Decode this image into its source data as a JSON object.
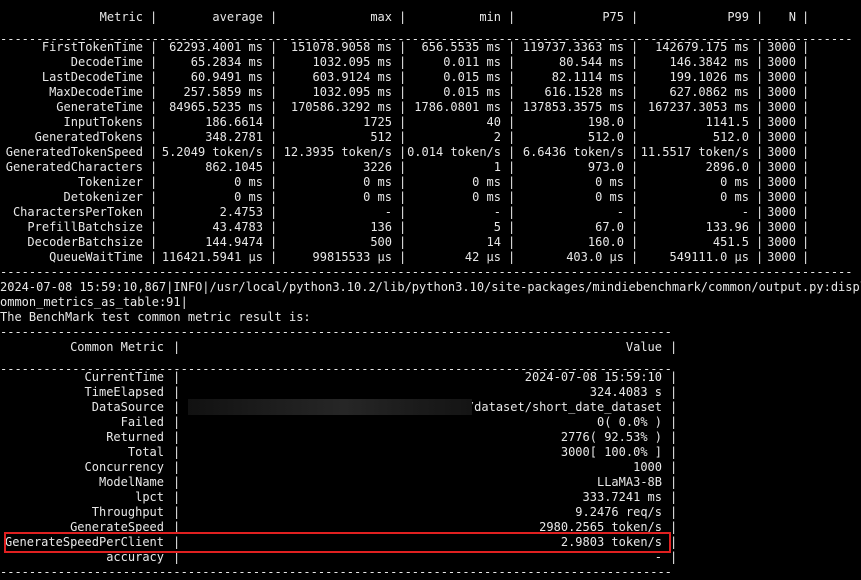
{
  "table1": {
    "headers": [
      "Metric",
      "average",
      "max",
      "min",
      "P75",
      "P99",
      "N"
    ],
    "rows": [
      [
        "FirstTokenTime",
        "62293.4001 ms",
        "151078.9058 ms",
        "656.5535 ms",
        "119737.3363 ms",
        "142679.175 ms",
        "3000"
      ],
      [
        "DecodeTime",
        "65.2834 ms",
        "1032.095 ms",
        "0.011 ms",
        "80.544 ms",
        "146.3842 ms",
        "3000"
      ],
      [
        "LastDecodeTime",
        "60.9491 ms",
        "603.9124 ms",
        "0.015 ms",
        "82.1114 ms",
        "199.1026 ms",
        "3000"
      ],
      [
        "MaxDecodeTime",
        "257.5859 ms",
        "1032.095 ms",
        "0.015 ms",
        "616.1528 ms",
        "627.0862 ms",
        "3000"
      ],
      [
        "GenerateTime",
        "84965.5235 ms",
        "170586.3292 ms",
        "1786.0801 ms",
        "137853.3575 ms",
        "167237.3053 ms",
        "3000"
      ],
      [
        "InputTokens",
        "186.6614",
        "1725",
        "40",
        "198.0",
        "1141.5",
        "3000"
      ],
      [
        "GeneratedTokens",
        "348.2781",
        "512",
        "2",
        "512.0",
        "512.0",
        "3000"
      ],
      [
        "GeneratedTokenSpeed",
        "5.2049 token/s",
        "12.3935 token/s",
        "0.014 token/s",
        "6.6436 token/s",
        "11.5517 token/s",
        "3000"
      ],
      [
        "GeneratedCharacters",
        "862.1045",
        "3226",
        "1",
        "973.0",
        "2896.0",
        "3000"
      ],
      [
        "Tokenizer",
        "0 ms",
        "0 ms",
        "0 ms",
        "0 ms",
        "0 ms",
        "3000"
      ],
      [
        "Detokenizer",
        "0 ms",
        "0 ms",
        "0 ms",
        "0 ms",
        "0 ms",
        "3000"
      ],
      [
        "CharactersPerToken",
        "2.4753",
        "-",
        "-",
        "-",
        "-",
        "3000"
      ],
      [
        "PrefillBatchsize",
        "43.4783",
        "136",
        "5",
        "67.0",
        "133.96",
        "3000"
      ],
      [
        "DecoderBatchsize",
        "144.9474",
        "500",
        "14",
        "160.0",
        "451.5",
        "3000"
      ],
      [
        "QueueWaitTime",
        "116421.5941 μs",
        "99815533 μs",
        "42 μs",
        "403.0 μs",
        "549111.0 μs",
        "3000"
      ]
    ]
  },
  "log": {
    "line1": "2024-07-08 15:59:10,867|INFO|/usr/local/python3.10.2/lib/python3.10/site-packages/mindiebenchmark/common/output.py:display_c",
    "line2": "ommon_metrics_as_table:91|",
    "line3": "The BenchMark test common metric result is:"
  },
  "table2": {
    "headers": [
      "Common Metric",
      "Value"
    ],
    "rows": [
      [
        "CurrentTime",
        "2024-07-08 15:59:10"
      ],
      [
        "TimeElapsed",
        "324.4083 s"
      ],
      [
        "DataSource",
        "./dataset/short_date_dataset"
      ],
      [
        "Failed",
        "0( 0.0% )"
      ],
      [
        "Returned",
        "2776( 92.53% )"
      ],
      [
        "Total",
        "3000[ 100.0% ]"
      ],
      [
        "Concurrency",
        "1000"
      ],
      [
        "ModelName",
        "LLaMA3-8B"
      ],
      [
        "lpct",
        "333.7241 ms"
      ],
      [
        "Throughput",
        "9.2476 req/s"
      ],
      [
        "GenerateSpeed",
        "2980.2565 token/s"
      ],
      [
        "GenerateSpeedPerClient",
        "2.9803 token/s"
      ],
      [
        "accuracy",
        "-"
      ]
    ],
    "highlight_row": "GenerateSpeedPerClient",
    "highlight_color": "#e02020"
  },
  "colors": {
    "background": "#000000",
    "text": "#e8e8e8"
  }
}
